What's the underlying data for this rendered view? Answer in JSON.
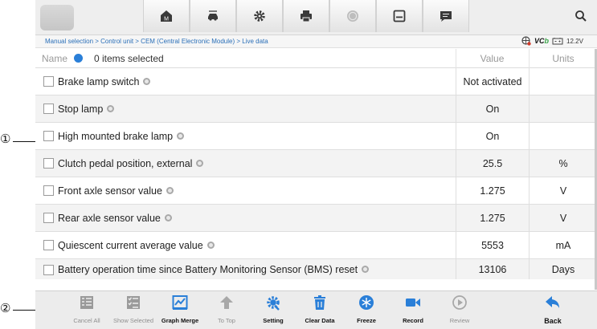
{
  "callouts": [
    "①",
    "②"
  ],
  "breadcrumb": "Manual selection > Control unit > CEM (Central Electronic Module) > Live data",
  "status": {
    "vci_prefix": "VC",
    "vci_suffix": "b",
    "voltage": "12.2V"
  },
  "table": {
    "name_header": "Name",
    "selection": "0 items selected",
    "value_header": "Value",
    "units_header": "Units",
    "rows": [
      {
        "label": "Brake lamp switch",
        "value": "Not activated",
        "unit": ""
      },
      {
        "label": "Stop lamp",
        "value": "On",
        "unit": ""
      },
      {
        "label": "High mounted brake lamp",
        "value": "On",
        "unit": ""
      },
      {
        "label": "Clutch pedal position, external",
        "value": "25.5",
        "unit": "%"
      },
      {
        "label": "Front axle sensor value",
        "value": "1.275",
        "unit": "V"
      },
      {
        "label": "Rear axle sensor value",
        "value": "1.275",
        "unit": "V"
      },
      {
        "label": "Quiescent current average value",
        "value": "5553",
        "unit": "mA"
      },
      {
        "label": "Battery operation time since Battery Monitoring Sensor (BMS) reset",
        "value": "13106",
        "unit": "Days"
      }
    ]
  },
  "toolbar_top": [
    "home-icon",
    "vehicle-swap-icon",
    "settings-icon",
    "print-icon",
    "help-icon",
    "save-icon",
    "message-icon",
    "search-icon"
  ],
  "toolbar_bottom": [
    {
      "label": "Cancel All",
      "icon": "cancel-all-icon",
      "state": "disabled"
    },
    {
      "label": "Show Selected",
      "icon": "show-selected-icon",
      "state": "disabled"
    },
    {
      "label": "Graph Merge",
      "icon": "graph-merge-icon",
      "state": "enabled"
    },
    {
      "label": "To Top",
      "icon": "to-top-icon",
      "state": "disabled"
    },
    {
      "label": "Setting",
      "icon": "setting-icon",
      "state": "enabled"
    },
    {
      "label": "Clear Data",
      "icon": "clear-data-icon",
      "state": "enabled"
    },
    {
      "label": "Freeze",
      "icon": "freeze-icon",
      "state": "enabled"
    },
    {
      "label": "Record",
      "icon": "record-icon",
      "state": "enabled"
    },
    {
      "label": "Review",
      "icon": "review-icon",
      "state": "disabled"
    },
    {
      "label": "Back",
      "icon": "back-icon",
      "state": "enabled"
    }
  ],
  "colors": {
    "accent": "#2a7fd8",
    "link": "#2a6fb8",
    "vci_green": "#3aa54a"
  }
}
